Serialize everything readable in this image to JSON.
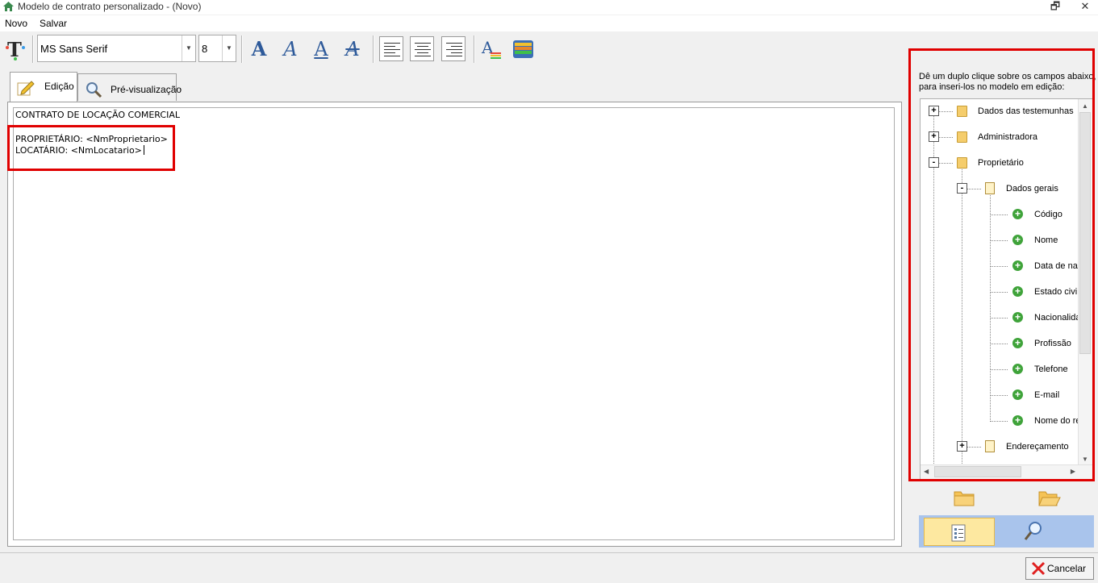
{
  "window": {
    "title": "Modelo de contrato personalizado - (Novo)"
  },
  "menu": {
    "items": [
      "Novo",
      "Salvar"
    ]
  },
  "toolbar": {
    "font_family": "MS Sans Serif",
    "font_size": "8",
    "format_glyphs": [
      "A",
      "A",
      "A",
      "A"
    ]
  },
  "tabs": [
    {
      "label": "Edição",
      "active": true
    },
    {
      "label": "Pré-visualização",
      "active": false
    }
  ],
  "editor": {
    "lines": [
      "CONTRATO DE LOCAÇÃO COMERCIAL",
      "",
      "PROPRIETÁRIO:  <NmProprietario>",
      "LOCATÁRIO: <NmLocatario>"
    ]
  },
  "fields_panel": {
    "instruction_line1": "Dê um duplo clique sobre os campos abaixo,",
    "instruction_line2": "para inseri-los no modelo em edição:",
    "tree": [
      {
        "label": "Dados das testemunhas",
        "expander": "+"
      },
      {
        "label": "Administradora",
        "expander": "+"
      },
      {
        "label": "Proprietário",
        "expander": "-"
      },
      {
        "label": "Dados gerais",
        "expander": "-"
      },
      {
        "label": "Código"
      },
      {
        "label": "Nome"
      },
      {
        "label": "Data de na"
      },
      {
        "label": "Estado civil"
      },
      {
        "label": "Nacionalida"
      },
      {
        "label": "Profissão"
      },
      {
        "label": "Telefone"
      },
      {
        "label": "E-mail"
      },
      {
        "label": "Nome do re"
      },
      {
        "label": "Endereçamento",
        "expander": "+"
      }
    ]
  },
  "buttons": {
    "cancel": "Cancelar"
  },
  "colors": {
    "highlight": "#e00000",
    "nav_bar": "#a9c4ec",
    "nav_active": "#fde8a0",
    "format_icon": "#2e5a9a"
  }
}
